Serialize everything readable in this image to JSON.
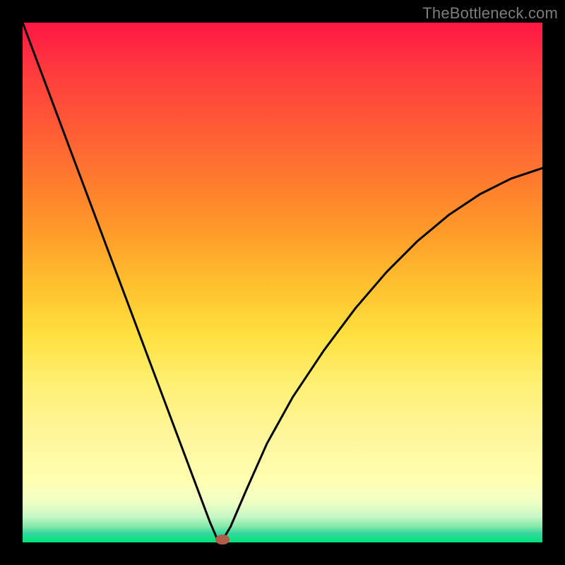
{
  "watermark": "TheBottleneck.com",
  "chart_data": {
    "type": "line",
    "title": "",
    "xlabel": "",
    "ylabel": "",
    "xlim": [
      0,
      100
    ],
    "ylim": [
      0,
      100
    ],
    "grid": false,
    "series": [
      {
        "name": "curve",
        "x": [
          0,
          3,
          6,
          9,
          12,
          15,
          18,
          21,
          24,
          27,
          30,
          33,
          36,
          37.5,
          38.5,
          40,
          43,
          47,
          52,
          58,
          64,
          70,
          76,
          82,
          88,
          94,
          100
        ],
        "y": [
          100,
          92,
          84,
          76,
          68,
          60,
          52,
          44,
          36,
          28,
          20,
          12,
          4,
          0.5,
          0.5,
          3,
          10,
          19,
          28,
          37,
          45,
          52,
          58,
          63,
          67,
          70,
          72
        ]
      }
    ],
    "marker": {
      "x_pct": 38.5,
      "y_pct": 0.5
    },
    "gradient_stops": [
      {
        "pct": 0,
        "color": "#ff1744"
      },
      {
        "pct": 50,
        "color": "#ffbf2e"
      },
      {
        "pct": 80,
        "color": "#fff59d"
      },
      {
        "pct": 100,
        "color": "#00e676"
      }
    ]
  }
}
